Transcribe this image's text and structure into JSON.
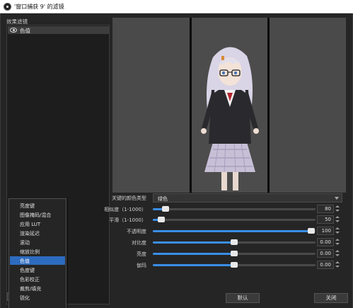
{
  "window": {
    "title": "'窗口捕获 9' 的滤镜"
  },
  "filters": {
    "label": "效果滤镜",
    "items": [
      {
        "label": "色值",
        "visible": true
      }
    ]
  },
  "props": {
    "key_color_type": {
      "label": "关键的颜色类型",
      "value": "绿色"
    },
    "similarity": {
      "label": "相似度（1-1000）",
      "value": "80",
      "fraction": 0.08
    },
    "smoothness": {
      "label": "平滑（1-1000）",
      "value": "50",
      "fraction": 0.05
    },
    "opacity": {
      "label": "不透明度",
      "value": "100",
      "fraction": 1.0
    },
    "contrast": {
      "label": "对比度",
      "value": "0.00",
      "fraction": 0.5
    },
    "brightness": {
      "label": "亮度",
      "value": "0.00",
      "fraction": 0.5
    },
    "gamma": {
      "label": "伽玛",
      "value": "0.00",
      "fraction": 0.5
    }
  },
  "buttons": {
    "defaults": "默认",
    "close": "关闭"
  },
  "context_menu": {
    "items": [
      {
        "label": "亮度键"
      },
      {
        "label": "图像掩码/混合"
      },
      {
        "label": "应用 LUT"
      },
      {
        "label": "渲染延迟"
      },
      {
        "label": "滚动"
      },
      {
        "label": "缩放比例"
      },
      {
        "label": "色值",
        "selected": true
      },
      {
        "label": "色度键"
      },
      {
        "label": "色彩校正"
      },
      {
        "label": "裁剪/填充"
      },
      {
        "label": "锐化"
      }
    ]
  },
  "colors": {
    "accent": "#3a8ee6",
    "menu_selection": "#2d6bbf"
  }
}
